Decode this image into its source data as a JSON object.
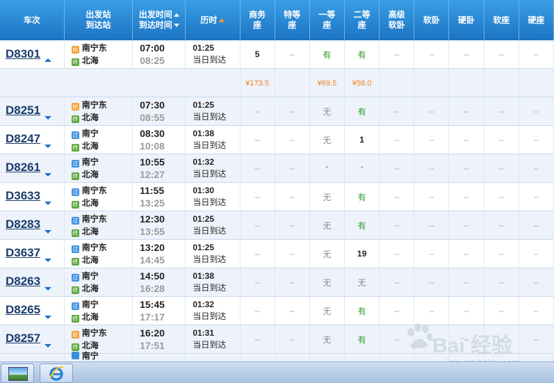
{
  "header": {
    "train": "车次",
    "station_line1": "出发站",
    "station_line2": "到达站",
    "time_line1": "出发时间",
    "time_line2": "到达时间",
    "duration": "历时",
    "seats": [
      "商务座",
      "特等座",
      "一等座",
      "二等座",
      "高级软卧",
      "软卧",
      "硬卧",
      "软座",
      "硬座"
    ]
  },
  "rows": [
    {
      "train": "D8301",
      "arrow": "up",
      "from_badge": "始",
      "from": "南宁东",
      "to_badge": "终",
      "to": "北海",
      "dep": "07:00",
      "arr": "08:25",
      "dur": "01:25",
      "dur_note": "当日到达",
      "seats": [
        "5",
        "--",
        "有",
        "有",
        "--",
        "--",
        "--",
        "--",
        "--"
      ]
    },
    {
      "train": "D8251",
      "arrow": "down",
      "from_badge": "始",
      "from": "南宁东",
      "to_badge": "终",
      "to": "北海",
      "dep": "07:30",
      "arr": "08:55",
      "dur": "01:25",
      "dur_note": "当日到达",
      "seats": [
        "--",
        "--",
        "无",
        "有",
        "--",
        "--",
        "--",
        "--",
        "--"
      ]
    },
    {
      "train": "D8247",
      "arrow": "down",
      "from_badge": "过",
      "from": "南宁",
      "to_badge": "终",
      "to": "北海",
      "dep": "08:30",
      "arr": "10:08",
      "dur": "01:38",
      "dur_note": "当日到达",
      "seats": [
        "--",
        "--",
        "无",
        "1",
        "--",
        "--",
        "--",
        "--",
        "--"
      ]
    },
    {
      "train": "D8261",
      "arrow": "down",
      "from_badge": "过",
      "from": "南宁",
      "to_badge": "终",
      "to": "北海",
      "dep": "10:55",
      "arr": "12:27",
      "dur": "01:32",
      "dur_note": "当日到达",
      "seats": [
        "--",
        "--",
        "*",
        "*",
        "--",
        "--",
        "--",
        "--",
        "--"
      ]
    },
    {
      "train": "D3633",
      "arrow": "down",
      "from_badge": "过",
      "from": "南宁东",
      "to_badge": "终",
      "to": "北海",
      "dep": "11:55",
      "arr": "13:25",
      "dur": "01:30",
      "dur_note": "当日到达",
      "seats": [
        "--",
        "--",
        "无",
        "有",
        "--",
        "--",
        "--",
        "--",
        "--"
      ]
    },
    {
      "train": "D8283",
      "arrow": "down",
      "from_badge": "过",
      "from": "南宁东",
      "to_badge": "终",
      "to": "北海",
      "dep": "12:30",
      "arr": "13:55",
      "dur": "01:25",
      "dur_note": "当日到达",
      "seats": [
        "--",
        "--",
        "无",
        "有",
        "--",
        "--",
        "--",
        "--",
        "--"
      ]
    },
    {
      "train": "D3637",
      "arrow": "down",
      "from_badge": "过",
      "from": "南宁东",
      "to_badge": "终",
      "to": "北海",
      "dep": "13:20",
      "arr": "14:45",
      "dur": "01:25",
      "dur_note": "当日到达",
      "seats": [
        "--",
        "--",
        "无",
        "19",
        "--",
        "--",
        "--",
        "--",
        "--"
      ]
    },
    {
      "train": "D8263",
      "arrow": "down",
      "from_badge": "过",
      "from": "南宁",
      "to_badge": "终",
      "to": "北海",
      "dep": "14:50",
      "arr": "16:28",
      "dur": "01:38",
      "dur_note": "当日到达",
      "seats": [
        "--",
        "--",
        "无",
        "无",
        "--",
        "--",
        "--",
        "--",
        "--"
      ]
    },
    {
      "train": "D8265",
      "arrow": "down",
      "from_badge": "过",
      "from": "南宁",
      "to_badge": "终",
      "to": "北海",
      "dep": "15:45",
      "arr": "17:17",
      "dur": "01:32",
      "dur_note": "当日到达",
      "seats": [
        "--",
        "--",
        "无",
        "有",
        "--",
        "--",
        "--",
        "--",
        "--"
      ]
    },
    {
      "train": "D8257",
      "arrow": "down",
      "from_badge": "始",
      "from": "南宁东",
      "to_badge": "终",
      "to": "北海",
      "dep": "16:20",
      "arr": "17:51",
      "dur": "01:31",
      "dur_note": "当日到达",
      "seats": [
        "--",
        "--",
        "无",
        "有",
        "--",
        "--",
        "--",
        "--",
        "--"
      ]
    }
  ],
  "price_row": [
    "¥173.5",
    "",
    "¥69.5",
    "¥58.0",
    "",
    "",
    "",
    "",
    ""
  ],
  "partial_row": {
    "from": "南宁"
  },
  "watermark": {
    "text": "Bai 经验",
    "url": "jingyan.baidu.com"
  },
  "colors": {
    "header": "#1b74c2",
    "available": "#2a9a2a",
    "price": "#f07e1e",
    "train_no": "#1a3c6b"
  }
}
